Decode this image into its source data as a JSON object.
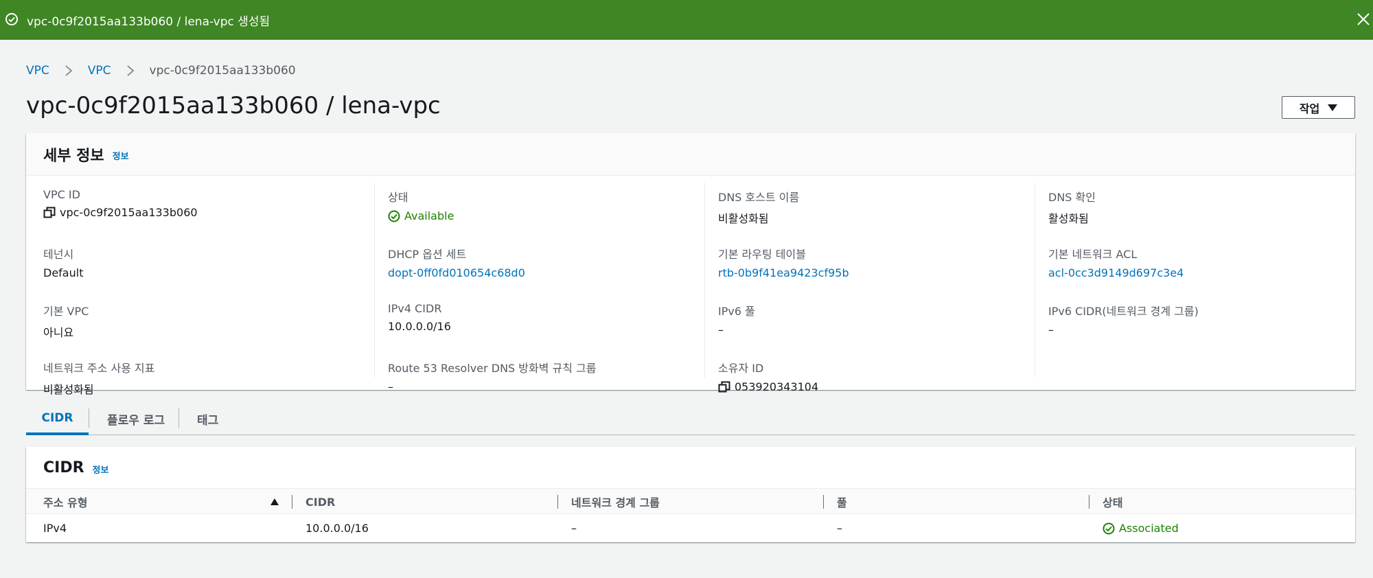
{
  "flash": {
    "message": "vpc-0c9f2015aa133b060 / lena-vpc 생성됨"
  },
  "breadcrumb": [
    "VPC",
    "VPC",
    "vpc-0c9f2015aa133b060"
  ],
  "page_title": "vpc-0c9f2015aa133b060 / lena-vpc",
  "actions_label": "작업",
  "details": {
    "title": "세부 정보",
    "info_link": "정보",
    "col1": [
      {
        "label": "VPC ID",
        "value": "vpc-0c9f2015aa133b060"
      },
      {
        "label": "테넌시",
        "value": "Default"
      },
      {
        "label": "기본 VPC",
        "value": "아니요"
      },
      {
        "label": "네트워크 주소 사용 지표",
        "value": "비활성화됨"
      }
    ],
    "col2": [
      {
        "label": "상태",
        "value": "Available"
      },
      {
        "label": "DHCP 옵션 세트",
        "value": "dopt-0ff0fd010654c68d0"
      },
      {
        "label": "IPv4 CIDR",
        "value": "10.0.0.0/16"
      },
      {
        "label": "Route 53 Resolver DNS 방화벽 규칙 그룹",
        "value": "–"
      }
    ],
    "col3": [
      {
        "label": "DNS 호스트 이름",
        "value": "비활성화됨"
      },
      {
        "label": "기본 라우팅 테이블",
        "value": "rtb-0b9f41ea9423cf95b"
      },
      {
        "label": "IPv6 풀",
        "value": "–"
      },
      {
        "label": "소유자 ID",
        "value": "053920343104"
      }
    ],
    "col4": [
      {
        "label": "DNS 확인",
        "value": "활성화됨"
      },
      {
        "label": "기본 네트워크 ACL",
        "value": "acl-0cc3d9149d697c3e4"
      },
      {
        "label": "IPv6 CIDR(네트워크 경계 그룹)",
        "value": "–"
      }
    ]
  },
  "tabs": [
    "CIDR",
    "플로우 로그",
    "태그"
  ],
  "cidr_panel": {
    "title": "CIDR",
    "info_link": "정보",
    "columns": [
      "주소 유형",
      "CIDR",
      "네트워크 경계 그룹",
      "풀",
      "상태"
    ],
    "rows": [
      [
        "IPv4",
        "10.0.0.0/16",
        "–",
        "–",
        "Associated"
      ]
    ]
  },
  "colors": {
    "flash_success": "#3f8624",
    "link": "#0073bb",
    "status_ok": "#1d8102"
  }
}
